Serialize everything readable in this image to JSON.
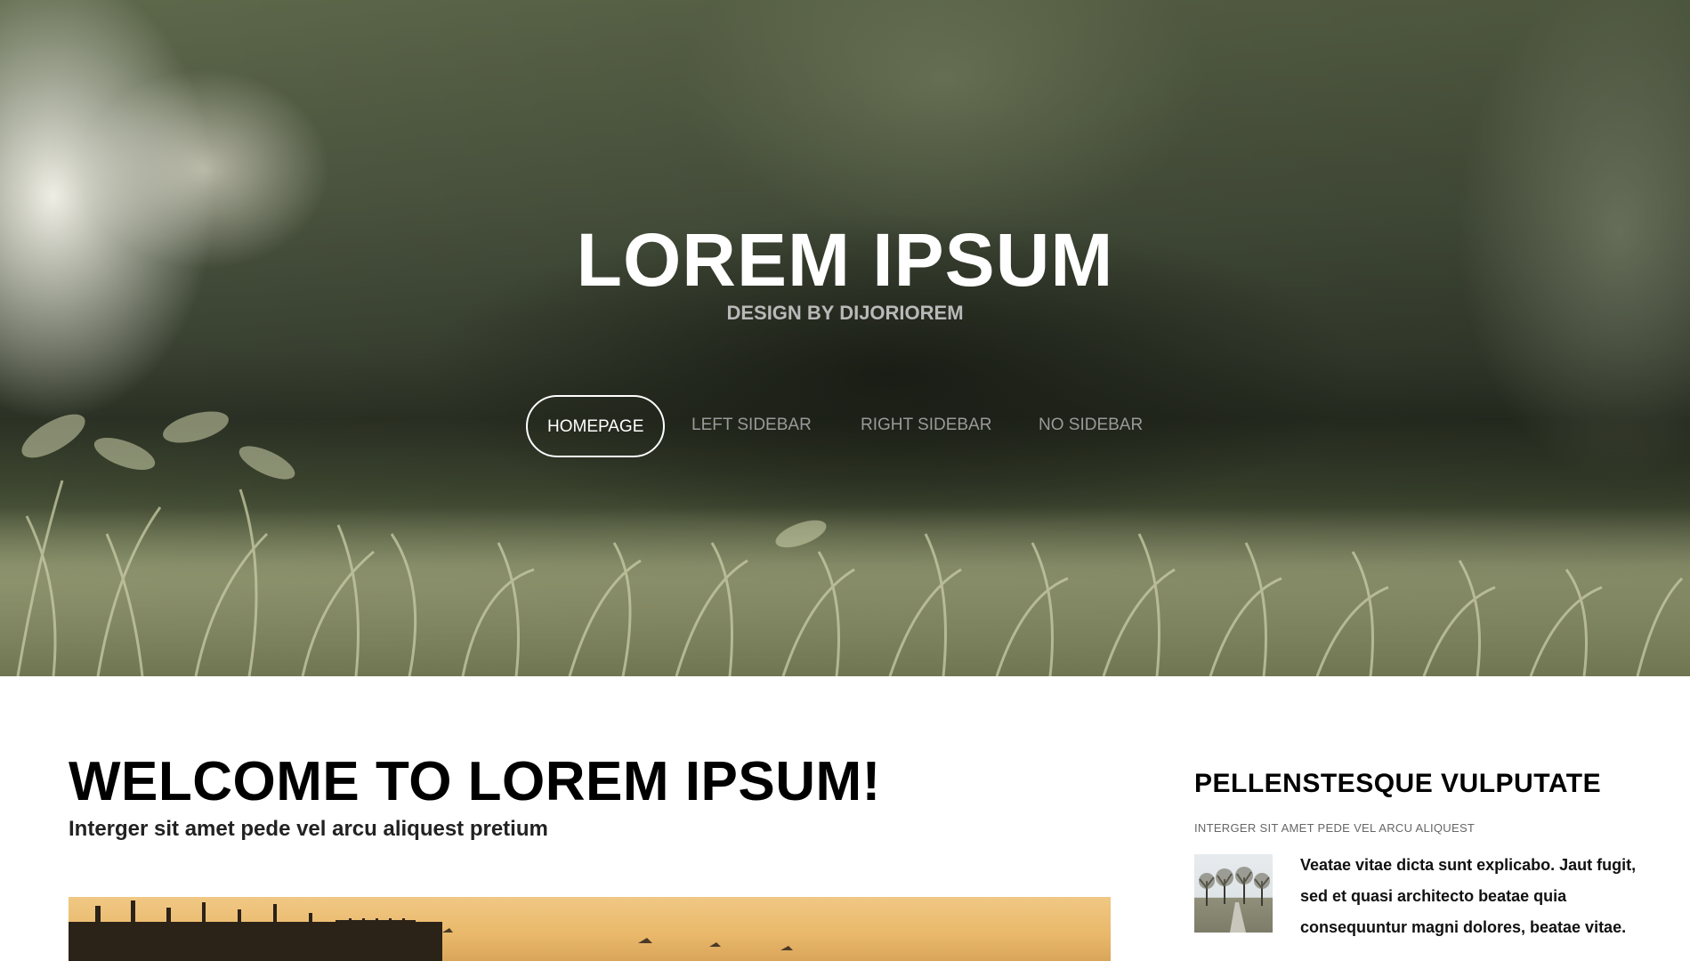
{
  "header": {
    "title": "LOREM IPSUM",
    "subtitle": "DESIGN BY DIJORIOREM"
  },
  "nav": {
    "items": [
      {
        "label": "HOMEPAGE",
        "active": true
      },
      {
        "label": "LEFT SIDEBAR",
        "active": false
      },
      {
        "label": "RIGHT SIDEBAR",
        "active": false
      },
      {
        "label": "NO SIDEBAR",
        "active": false
      }
    ]
  },
  "main": {
    "title": "WELCOME TO LOREM IPSUM!",
    "subtitle": "Interger sit amet pede vel arcu aliquest pretium"
  },
  "sidebar": {
    "title": "PELLENSTESQUE VULPUTATE",
    "meta": "INTERGER SIT AMET PEDE VEL ARCU ALIQUEST",
    "text": "Veatae vitae dicta sunt explicabo. Jaut fugit, sed et quasi architecto beatae quia consequuntur magni dolores, beatae vitae."
  },
  "colors": {
    "nav_active": "#ffffff",
    "nav_inactive": "#9a9a9a",
    "subtitle": "#b9b9b9",
    "heading": "#000000"
  }
}
